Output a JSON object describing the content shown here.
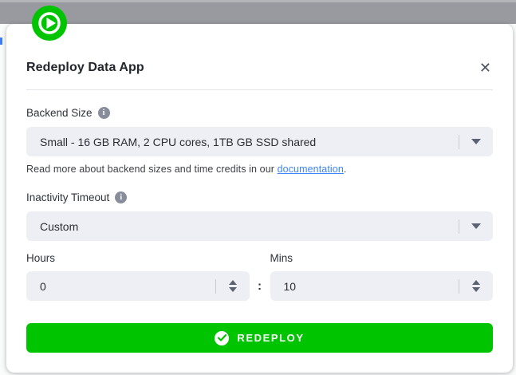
{
  "modal": {
    "title": "Redeploy Data App",
    "backend_size": {
      "label": "Backend Size",
      "value": "Small - 16 GB RAM, 2 CPU cores, 1TB GB SSD shared",
      "helper_prefix": "Read more about backend sizes and time credits in our ",
      "helper_link": "documentation",
      "helper_suffix": "."
    },
    "inactivity_timeout": {
      "label": "Inactivity Timeout",
      "value": "Custom"
    },
    "hours": {
      "label": "Hours",
      "value": "0"
    },
    "mins": {
      "label": "Mins",
      "value": "10"
    },
    "time_separator": ":",
    "redeploy_button": {
      "label": "REDEPLOY"
    }
  },
  "icons": {
    "close": "✕",
    "info": "i"
  },
  "colors": {
    "accent_green": "#00c400",
    "link_blue": "#3e86f5",
    "field_bg": "#edeff4",
    "overlay_gray": "#989aa0"
  }
}
